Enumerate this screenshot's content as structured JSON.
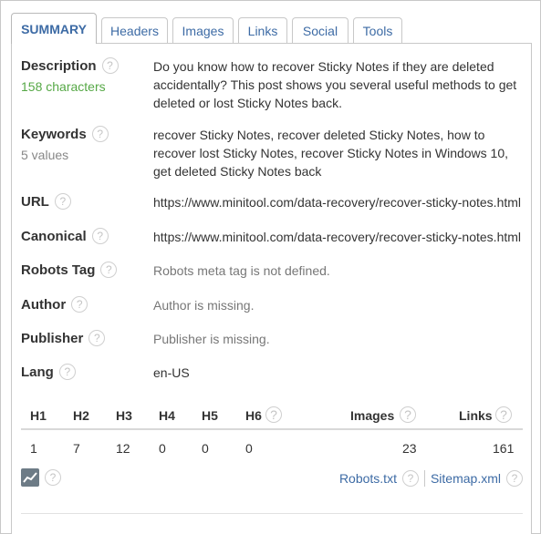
{
  "tabs": [
    {
      "label": "SUMMARY",
      "active": true
    },
    {
      "label": "Headers"
    },
    {
      "label": "Images"
    },
    {
      "label": "Links"
    },
    {
      "label": "Social"
    },
    {
      "label": "Tools"
    }
  ],
  "help_glyph": "?",
  "summary": {
    "description": {
      "label": "Description",
      "sub": "158 characters",
      "value": "Do you know how to recover Sticky Notes if they are deleted accidentally? This post shows you several useful methods to get deleted or lost Sticky Notes back."
    },
    "keywords": {
      "label": "Keywords",
      "sub": "5 values",
      "value": "recover Sticky Notes, recover deleted Sticky Notes, how to recover lost Sticky Notes, recover Sticky Notes in Windows 10, get deleted Sticky Notes back"
    },
    "url": {
      "label": "URL",
      "value": "https://www.minitool.com/data-recovery/recover-sticky-notes.html"
    },
    "canonical": {
      "label": "Canonical",
      "value": "https://www.minitool.com/data-recovery/recover-sticky-notes.html"
    },
    "robots": {
      "label": "Robots Tag",
      "value": "Robots meta tag is not defined."
    },
    "author": {
      "label": "Author",
      "value": "Author is missing."
    },
    "publisher": {
      "label": "Publisher",
      "value": "Publisher is missing."
    },
    "lang": {
      "label": "Lang",
      "value": "en-US"
    }
  },
  "stats": {
    "headers": [
      "H1",
      "H2",
      "H3",
      "H4",
      "H5",
      "H6"
    ],
    "header_values": [
      "1",
      "7",
      "12",
      "0",
      "0",
      "0"
    ],
    "images_label": "Images",
    "images_value": "23",
    "links_label": "Links",
    "links_value": "161"
  },
  "footer": {
    "chart_icon": "chart-icon",
    "robots_link": "Robots.txt",
    "sitemap_link": "Sitemap.xml"
  },
  "colors": {
    "accent": "#3d6ba5",
    "green": "#56a846",
    "muted": "#888888"
  }
}
